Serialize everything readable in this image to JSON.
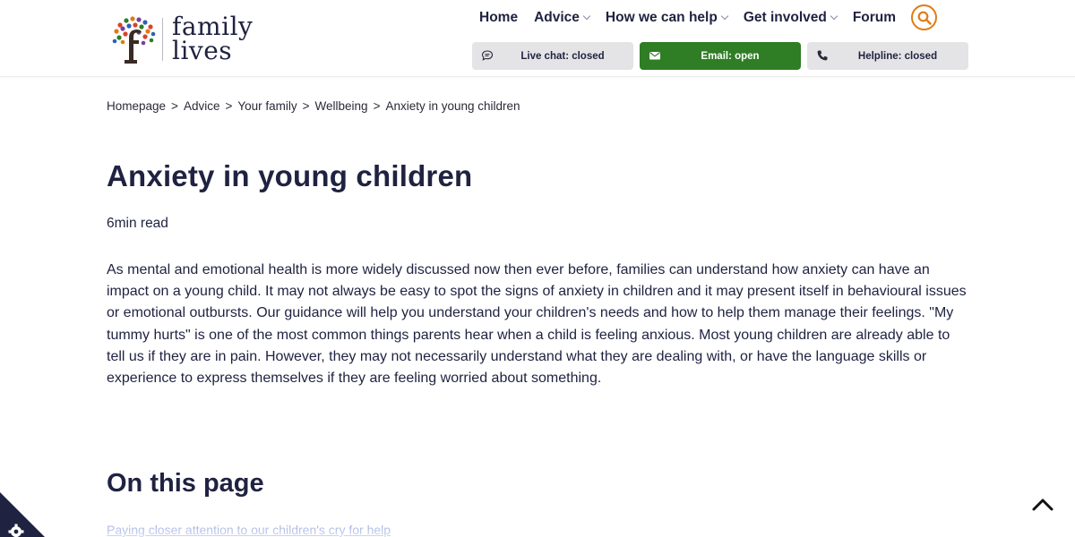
{
  "brand": {
    "line1": "family",
    "line2": "lives",
    "letter": "f"
  },
  "nav": {
    "home": "Home",
    "advice": "Advice",
    "how_we_help": "How we can help",
    "get_involved": "Get involved",
    "forum": "Forum"
  },
  "contact": {
    "live_chat": "Live chat: closed",
    "email": "Email: open",
    "helpline": "Helpline: closed"
  },
  "breadcrumb": {
    "items": [
      "Homepage",
      "Advice",
      "Your family",
      "Wellbeing",
      "Anxiety in young children"
    ],
    "separator": ">"
  },
  "article": {
    "title": "Anxiety in young children",
    "read_time": "6min read",
    "intro": "As mental and emotional health is more widely discussed now then ever before, families can understand how anxiety can have an impact on a young child. It may not always be easy to spot the signs of anxiety in children and it may present itself in behavioural issues or emotional outbursts. Our guidance will help you understand your children's needs and how to help them manage their feelings. \"My tummy hurts\" is one of the most common things parents hear when a child is feeling anxious. Most young children are already able to tell us if they are in pain. However, they may not necessarily understand what they are dealing with, or have the language skills or experience to express themselves if they are feeling worried about something."
  },
  "toc": {
    "heading": "On this page",
    "links": [
      "Paying closer attention to our children's cry for help"
    ]
  },
  "colors": {
    "navy": "#1f2240",
    "accent_orange": "#e07b14",
    "email_green": "#2f7d24",
    "link_blue": "#4a67c6",
    "button_grey": "#e4e4e6"
  },
  "icons": {
    "search": "search-icon",
    "chat": "chat-bubble-icon",
    "email": "envelope-icon",
    "phone": "phone-icon",
    "back_to_top": "chevron-up-icon",
    "cookie": "cookie-settings-icon"
  }
}
